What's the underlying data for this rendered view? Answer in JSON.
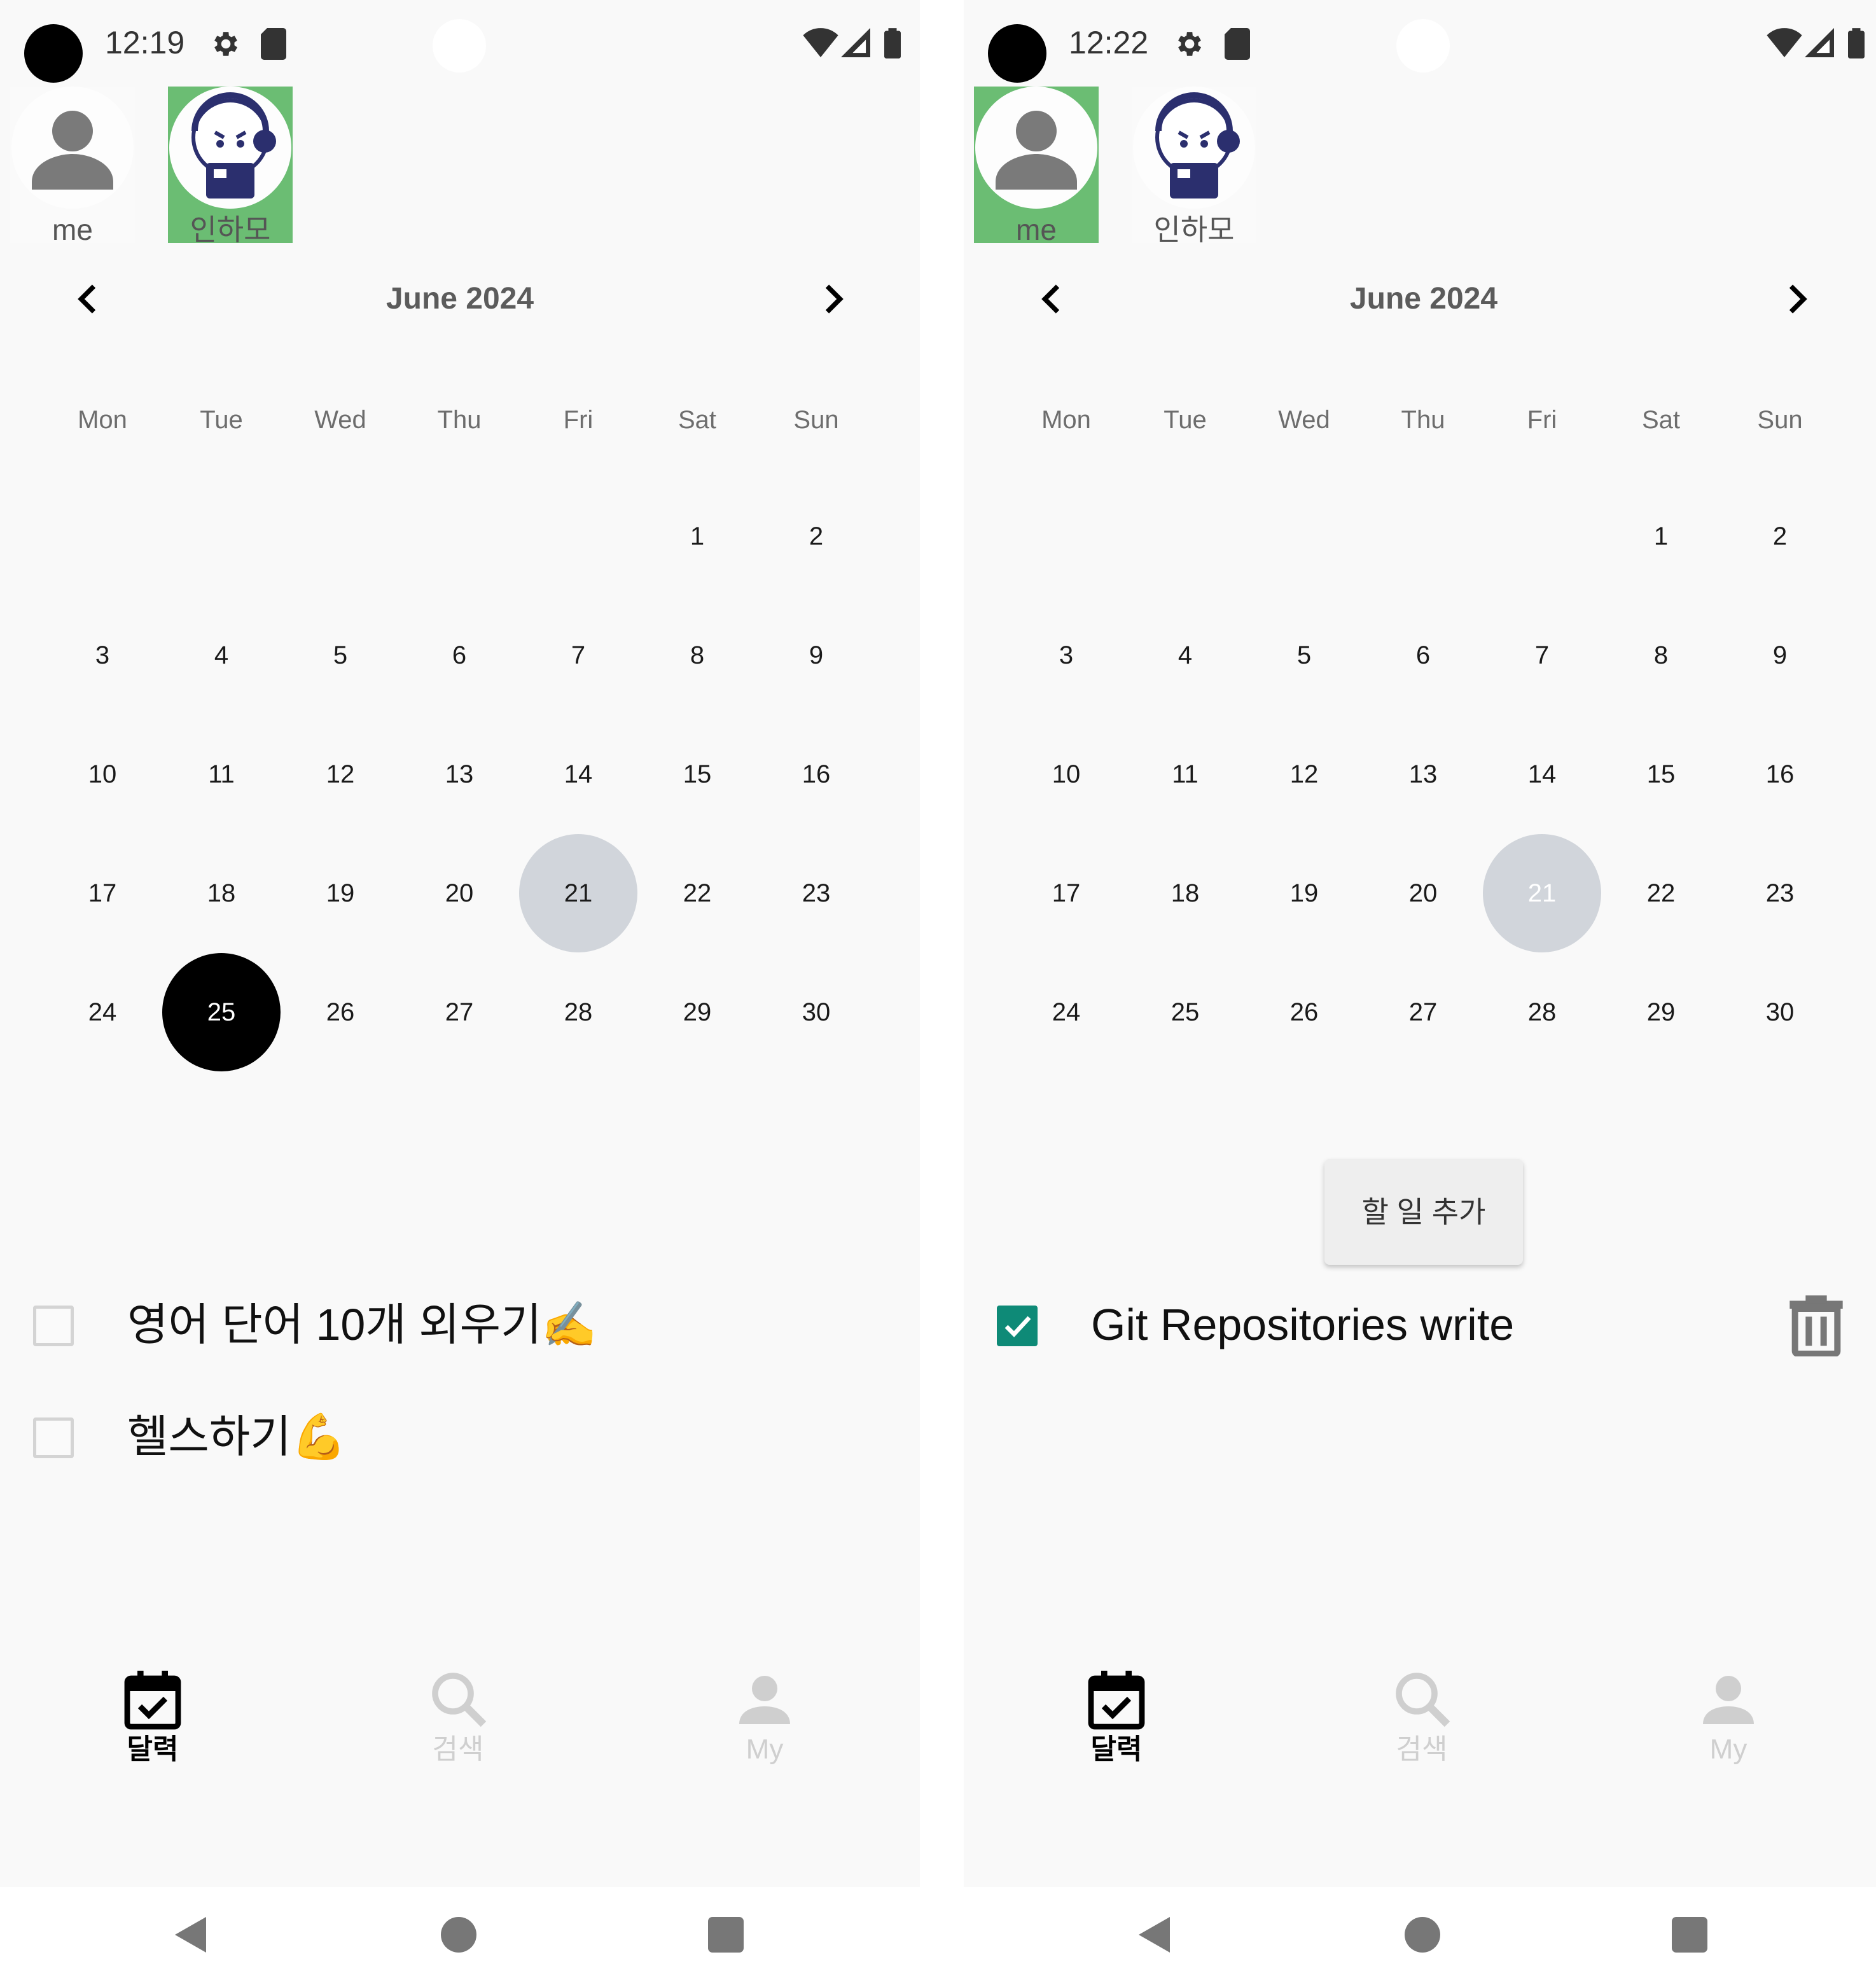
{
  "screens": [
    {
      "status": {
        "time": "12:19"
      },
      "profiles": [
        {
          "name": "me",
          "selected": false,
          "icon": "person-icon"
        },
        {
          "name": "인하모",
          "selected": true,
          "icon": "mascot-avatar"
        }
      ],
      "calendar": {
        "month_title": "June 2024",
        "weekdays": [
          "Mon",
          "Tue",
          "Wed",
          "Thu",
          "Fri",
          "Sat",
          "Sun"
        ],
        "first_weekday_index": 5,
        "days_in_month": 30,
        "today": 21,
        "selected": 25
      },
      "add_button": null,
      "todos": [
        {
          "text": "영어 단어 10개 외우기✍️",
          "checked": false,
          "deletable": false
        },
        {
          "text": "헬스하기💪",
          "checked": false,
          "deletable": false
        }
      ],
      "bottom_nav": [
        {
          "label": "달력",
          "icon": "calendar-check-icon",
          "active": true
        },
        {
          "label": "검색",
          "icon": "search-icon",
          "active": false
        },
        {
          "label": "My",
          "icon": "person-icon",
          "active": false
        }
      ]
    },
    {
      "status": {
        "time": "12:22"
      },
      "profiles": [
        {
          "name": "me",
          "selected": true,
          "icon": "person-icon"
        },
        {
          "name": "인하모",
          "selected": false,
          "icon": "mascot-avatar"
        }
      ],
      "calendar": {
        "month_title": "June 2024",
        "weekdays": [
          "Mon",
          "Tue",
          "Wed",
          "Thu",
          "Fri",
          "Sat",
          "Sun"
        ],
        "first_weekday_index": 5,
        "days_in_month": 30,
        "today": 21,
        "selected": null
      },
      "add_button": "할 일 추가",
      "todos": [
        {
          "text": "Git Repositories write",
          "checked": true,
          "deletable": true
        }
      ],
      "bottom_nav": [
        {
          "label": "달력",
          "icon": "calendar-check-icon",
          "active": true
        },
        {
          "label": "검색",
          "icon": "search-icon",
          "active": false
        },
        {
          "label": "My",
          "icon": "person-icon",
          "active": false
        }
      ]
    }
  ],
  "colors": {
    "selected_profile": "#6bbd73",
    "today_circle": "#d1d5db",
    "selected_day": "#000000",
    "checkbox_checked": "#0e8a77",
    "app_background": "#f9f9f9"
  }
}
